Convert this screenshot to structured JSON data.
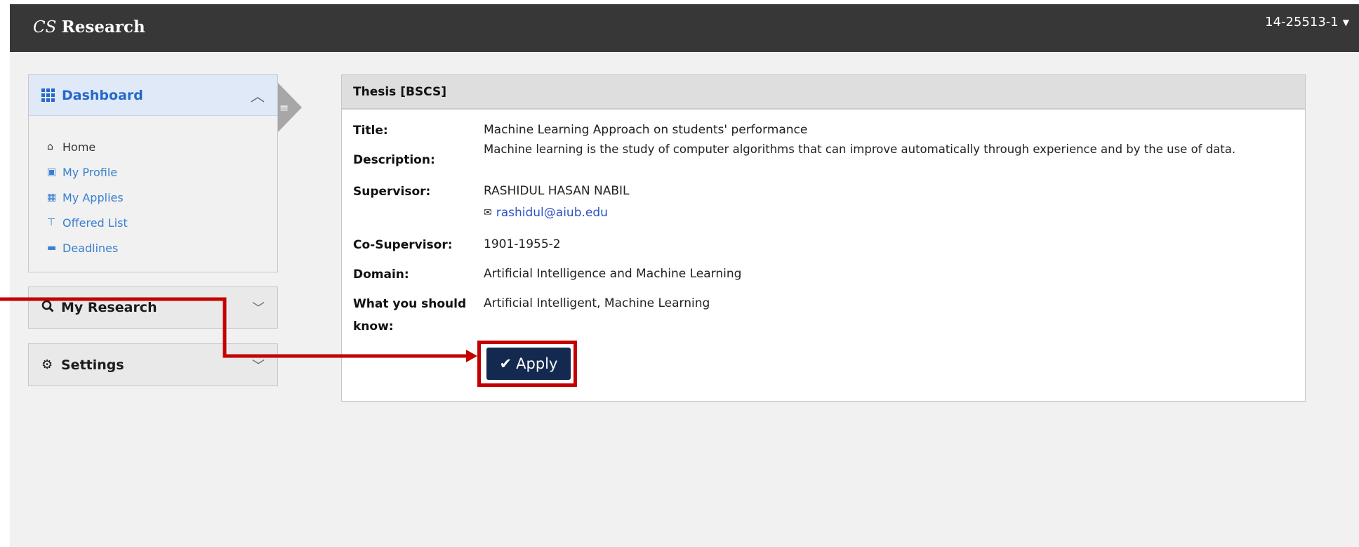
{
  "header": {
    "brand_prefix": "CS",
    "brand_name": "Research",
    "user_id": "14-25513-1"
  },
  "sidebar": {
    "dashboard_label": "Dashboard",
    "items": [
      {
        "label": "Home",
        "icon": "home-icon"
      },
      {
        "label": "My Profile",
        "icon": "briefcase-icon"
      },
      {
        "label": "My Applies",
        "icon": "calendar-icon"
      },
      {
        "label": "Offered List",
        "icon": "pin-icon"
      },
      {
        "label": "Deadlines",
        "icon": "folder-icon"
      }
    ],
    "research_label": "My Research",
    "settings_label": "Settings"
  },
  "thesis": {
    "heading": "Thesis [BSCS]",
    "title_label": "Title:",
    "title_value": "Machine Learning Approach on students' performance",
    "description_label": "Description:",
    "description_value": "Machine learning is the study of computer algorithms that can improve automatically through experience and by the use of data.",
    "supervisor_label": "Supervisor:",
    "supervisor_value": "RASHIDUL HASAN NABIL",
    "supervisor_email": "rashidul@aiub.edu",
    "cosupervisor_label": "Co-Supervisor:",
    "cosupervisor_value": "1901-1955-2",
    "domain_label": "Domain:",
    "domain_value": "Artificial Intelligence and Machine Learning",
    "know_label": "What you should know:",
    "know_value": "Artificial Intelligent, Machine Learning",
    "apply_label": "Apply"
  },
  "colors": {
    "topbar": "#373737",
    "accent": "#2667c9",
    "button": "#14294f",
    "annotation": "#c40000"
  }
}
